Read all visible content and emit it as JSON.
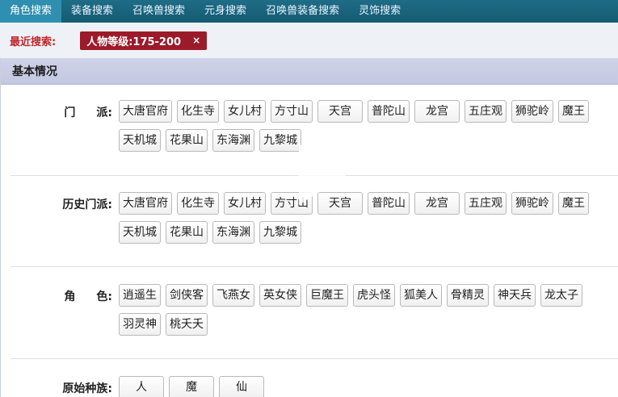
{
  "nav": {
    "tabs": [
      "角色搜索",
      "装备搜索",
      "召唤兽搜索",
      "元身搜索",
      "召唤兽装备搜索",
      "灵饰搜索"
    ]
  },
  "recent": {
    "label": "最近搜索:",
    "tag": "人物等级:175-200",
    "close": "×"
  },
  "panel": {
    "title": "基本情况",
    "sections": [
      {
        "label_a": "门",
        "label_b": "派:",
        "items": [
          "大唐官府",
          "化生寺",
          "女儿村",
          "方寸山",
          "天宫",
          "普陀山",
          "龙宫",
          "五庄观",
          "狮驼岭",
          "魔王",
          "天机城",
          "花果山",
          "东海渊",
          "九黎城"
        ]
      },
      {
        "label": "历史门派:",
        "items": [
          "大唐官府",
          "化生寺",
          "女儿村",
          "方寸山",
          "天宫",
          "普陀山",
          "龙宫",
          "五庄观",
          "狮驼岭",
          "魔王",
          "天机城",
          "花果山",
          "东海渊",
          "九黎城"
        ]
      },
      {
        "label_a": "角",
        "label_b": "色:",
        "items": [
          "逍遥生",
          "剑侠客",
          "飞燕女",
          "英女侠",
          "巨魔王",
          "虎头怪",
          "狐美人",
          "骨精灵",
          "神天兵",
          "龙太子",
          "羽灵神",
          "桃夭夭"
        ]
      },
      {
        "label": "原始种族:",
        "items": [
          "人",
          "魔",
          "仙"
        ]
      }
    ]
  }
}
